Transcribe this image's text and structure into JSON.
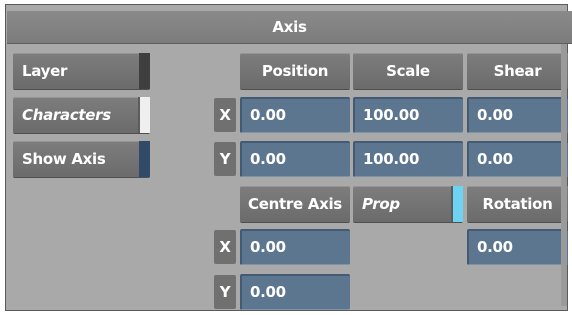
{
  "panel": {
    "title": "Axis"
  },
  "left_buttons": {
    "layer": "Layer",
    "characters": "Characters",
    "show_axis": "Show Axis"
  },
  "headers": {
    "position": "Position",
    "scale": "Scale",
    "shear": "Shear"
  },
  "axis_labels": {
    "x": "X",
    "y": "Y"
  },
  "values": {
    "position_x": "0.00",
    "position_y": "0.00",
    "scale_x": "100.00",
    "scale_y": "100.00",
    "shear_x": "0.00",
    "shear_y": "0.00",
    "centre_x": "0.00",
    "centre_y": "0.00",
    "rotation": "0.00"
  },
  "centre_axis": {
    "button": "Centre Axis",
    "mode": "Prop"
  },
  "rotation_label": "Rotation",
  "colors": {
    "panel_bg": "#a9a9a9",
    "field_bg": "#5c7690",
    "button_bg": "#747474",
    "prop_indicator": "#6ed3f2"
  }
}
